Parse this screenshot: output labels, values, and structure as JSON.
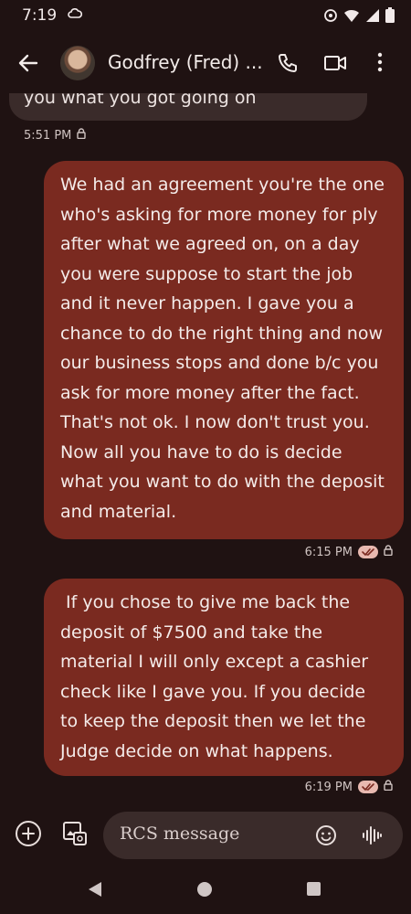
{
  "status_bar": {
    "time": "7:19"
  },
  "header": {
    "contact_name": "Godfrey (Fred) ..."
  },
  "messages": [
    {
      "direction": "received",
      "text": "you what you got going on",
      "time": "5:51 PM"
    },
    {
      "direction": "sent",
      "text": "We had an agreement you're the one who's asking for more money for ply after what we agreed on, on a day you were suppose to start the job and it never happen. I gave you a chance to do the right thing and now our business stops and done b/c you ask for more money after the fact. That's not ok. I now don't trust you. Now all you have to do is decide what you want to do with the deposit and material.",
      "time": "6:15 PM"
    },
    {
      "direction": "sent",
      "text": " If you chose to give me back the deposit of $7500 and take the material I will only except a cashier check like I gave you. If you decide to keep the deposit then we let the Judge decide on what happens.",
      "time": "6:19 PM"
    }
  ],
  "compose": {
    "placeholder": "RCS message"
  },
  "colors": {
    "background": "#1f1212",
    "sent_bubble": "#7a2a20",
    "received_bubble": "#3a2b2a",
    "read_badge": "#e8b9b0"
  }
}
